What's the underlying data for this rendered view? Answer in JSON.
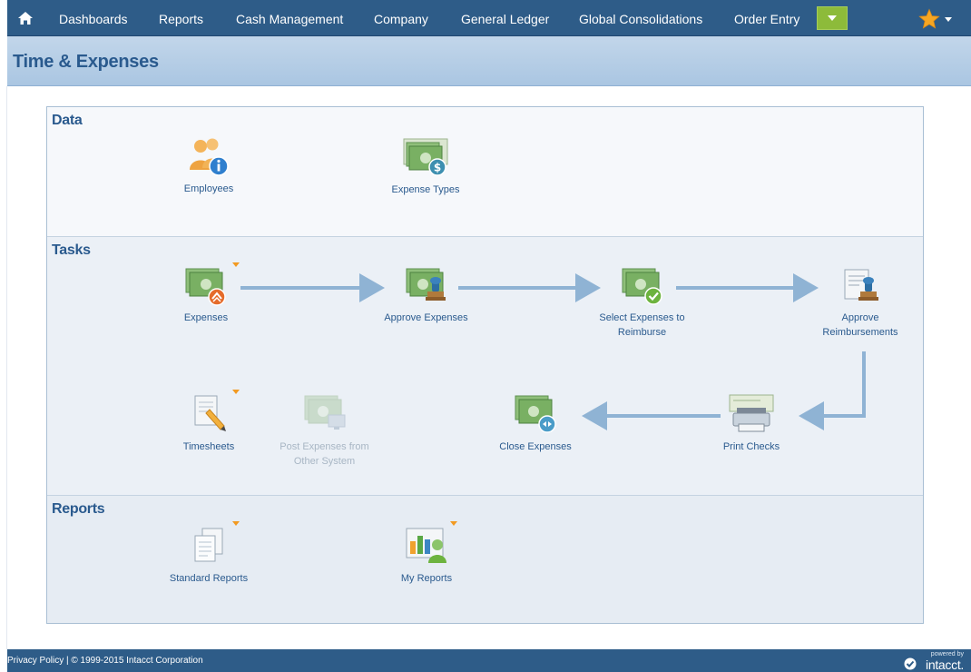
{
  "nav": {
    "items": [
      "Dashboards",
      "Reports",
      "Cash Management",
      "Company",
      "General Ledger",
      "Global Consolidations",
      "Order Entry"
    ]
  },
  "page": {
    "title": "Time & Expenses"
  },
  "sections": {
    "data": {
      "title": "Data",
      "items": [
        "Employees",
        "Expense Types"
      ]
    },
    "tasks": {
      "title": "Tasks",
      "expenses": "Expenses",
      "approve_expenses": "Approve Expenses",
      "select_to_reimburse": "Select Expenses to Reimburse",
      "approve_reimbursements": "Approve Reimbursements",
      "timesheets": "Timesheets",
      "post_expenses": "Post Expenses from Other System",
      "close_expenses": "Close Expenses",
      "print_checks": "Print Checks"
    },
    "reports": {
      "title": "Reports",
      "items": [
        "Standard Reports",
        "My Reports"
      ]
    }
  },
  "footer": {
    "privacy": "Privacy Policy",
    "separator": " | ",
    "copyright": "© 1999-2015  Intacct Corporation",
    "powered_by": "powered by",
    "brand": "intacct."
  },
  "colors": {
    "nav_bg": "#2e5c88",
    "title_band": "#b3cde6",
    "accent_text": "#2a5a8e",
    "more_button": "#8dbb3a",
    "caret": "#f29a21",
    "arrow": "#8fb3d4"
  },
  "icons": {
    "home": "home-icon",
    "favorites": "star-icon",
    "employees": "employees-info-icon",
    "expense_types": "money-dollar-icon",
    "expenses": "money-submit-icon",
    "approve_expenses": "money-stamp-icon",
    "select_reimburse": "money-check-icon",
    "approve_reimbursements": "document-stamp-icon",
    "timesheets": "document-pencil-icon",
    "post_expenses": "money-computer-icon",
    "close_expenses": "money-close-icon",
    "print_checks": "printer-icon",
    "standard_reports": "documents-icon",
    "my_reports": "report-chart-user-icon"
  }
}
